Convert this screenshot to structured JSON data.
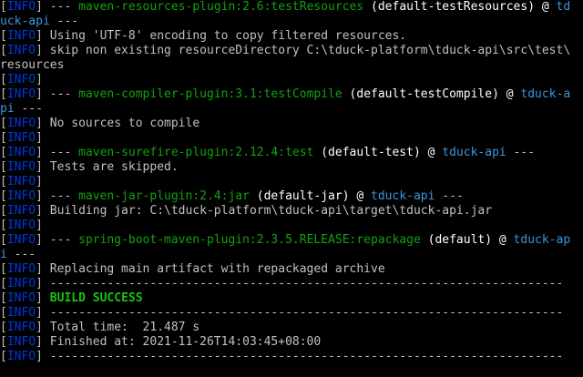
{
  "console": {
    "level_label": "INFO",
    "lines": [
      {
        "type": "plugin",
        "pre": "--- ",
        "plugin": "maven-resources-plugin:2.6:testResources",
        "goal": " (default-testResources) @ ",
        "project": "td"
      },
      {
        "type": "plain",
        "parts": [
          {
            "cls": "proj",
            "text": "uck-api"
          },
          {
            "cls": "text",
            "text": " ---"
          }
        ]
      },
      {
        "type": "info",
        "text": " Using 'UTF-8' encoding to copy filtered resources."
      },
      {
        "type": "info",
        "text": " skip non existing resourceDirectory C:\\tduck-platform\\tduck-api\\src\\test\\"
      },
      {
        "type": "plain",
        "parts": [
          {
            "cls": "text",
            "text": "resources"
          }
        ]
      },
      {
        "type": "info",
        "text": ""
      },
      {
        "type": "plugin",
        "pre": "--- ",
        "plugin": "maven-compiler-plugin:3.1:testCompile",
        "goal": " (default-testCompile) @ ",
        "project": "tduck-a"
      },
      {
        "type": "plain",
        "parts": [
          {
            "cls": "proj",
            "text": "pi"
          },
          {
            "cls": "text",
            "text": " ---"
          }
        ]
      },
      {
        "type": "info",
        "text": " No sources to compile"
      },
      {
        "type": "info",
        "text": ""
      },
      {
        "type": "plugin",
        "pre": "--- ",
        "plugin": "maven-surefire-plugin:2.12.4:test",
        "goal": " (default-test) @ ",
        "project": "tduck-api",
        "post": " ---"
      },
      {
        "type": "info",
        "text": " Tests are skipped."
      },
      {
        "type": "info",
        "text": ""
      },
      {
        "type": "plugin",
        "pre": "--- ",
        "plugin": "maven-jar-plugin:2.4:jar",
        "goal": " (default-jar) @ ",
        "project": "tduck-api",
        "post": " ---"
      },
      {
        "type": "info",
        "text": " Building jar: C:\\tduck-platform\\tduck-api\\target\\tduck-api.jar"
      },
      {
        "type": "info",
        "text": ""
      },
      {
        "type": "plugin",
        "pre": "--- ",
        "plugin": "spring-boot-maven-plugin:2.3.5.RELEASE:repackage",
        "goal": " (default) @ ",
        "project": "tduck-ap"
      },
      {
        "type": "plain",
        "parts": [
          {
            "cls": "proj",
            "text": "i"
          },
          {
            "cls": "text",
            "text": " ---"
          }
        ]
      },
      {
        "type": "info",
        "text": " Replacing main artifact with repackaged archive"
      },
      {
        "type": "info",
        "text": " ------------------------------------------------------------------------"
      },
      {
        "type": "success",
        "text": "BUILD SUCCESS"
      },
      {
        "type": "info",
        "text": " ------------------------------------------------------------------------"
      },
      {
        "type": "info",
        "text": " Total time:  21.487 s"
      },
      {
        "type": "info",
        "text": " Finished at: 2021-11-26T14:03:45+08:00"
      },
      {
        "type": "info",
        "text": " ------------------------------------------------------------------------"
      }
    ]
  }
}
